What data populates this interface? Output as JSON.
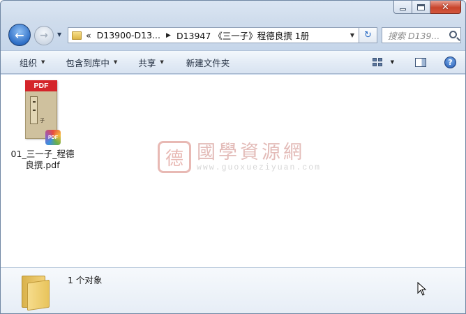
{
  "window": {
    "close_glyph": "✕"
  },
  "nav": {
    "back_glyph": "←",
    "forward_glyph": "→",
    "breadcrumbs": [
      {
        "label": "D13900-D13..."
      },
      {
        "label": "D13947 《三一子》程德良撰 1册"
      }
    ],
    "chevron_glyph": "«",
    "separator_glyph": "▶",
    "refresh_glyph": "↻",
    "search_placeholder": "搜索 D139..."
  },
  "toolbar": {
    "organize_label": "组织",
    "include_label": "包含到库中",
    "share_label": "共享",
    "new_folder_label": "新建文件夹",
    "help_glyph": "?"
  },
  "files": [
    {
      "name": "01_三一子_程德良撰.pdf",
      "thumb_band": "PDF",
      "thumb_glyph": "子",
      "badge": "PDF"
    }
  ],
  "watermark": {
    "seal_glyph": "德",
    "title": "國學資源網",
    "url": "www.guoxueziyuan.com"
  },
  "details": {
    "object_count": "1 个对象"
  },
  "colors": {
    "accent": "#2f6fc6",
    "pdf_red": "#d4242a",
    "close_red": "#c8442c"
  }
}
